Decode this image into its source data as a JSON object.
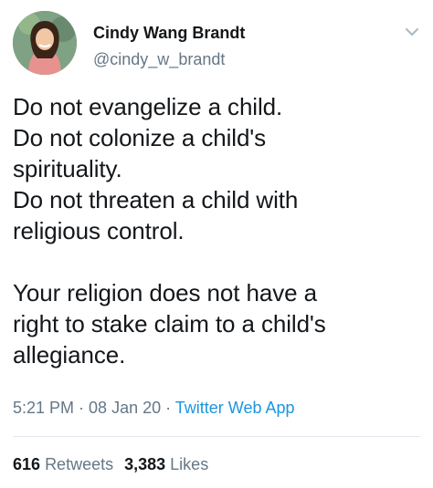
{
  "author": {
    "name": "Cindy Wang Brandt",
    "handle": "@cindy_w_brandt"
  },
  "tweet": {
    "text": "Do not evangelize a child.\nDo not colonize a child's\nspirituality.\nDo not threaten a child with\nreligious control.\n\nYour religion does not have a\nright to stake claim to a child's\nallegiance."
  },
  "meta": {
    "time": "5:21 PM",
    "sep1": " · ",
    "date": "08 Jan 20",
    "sep2": " · ",
    "app": "Twitter Web App"
  },
  "stats": {
    "retweets_count": "616",
    "retweets_label": "Retweets",
    "likes_count": "3,383",
    "likes_label": "Likes"
  },
  "icons": {
    "menu": "chevron-down-icon",
    "avatar": "avatar"
  },
  "colors": {
    "text": "#14171a",
    "secondary": "#657786",
    "link": "#1b95e0",
    "divider": "#e1e8ed"
  }
}
